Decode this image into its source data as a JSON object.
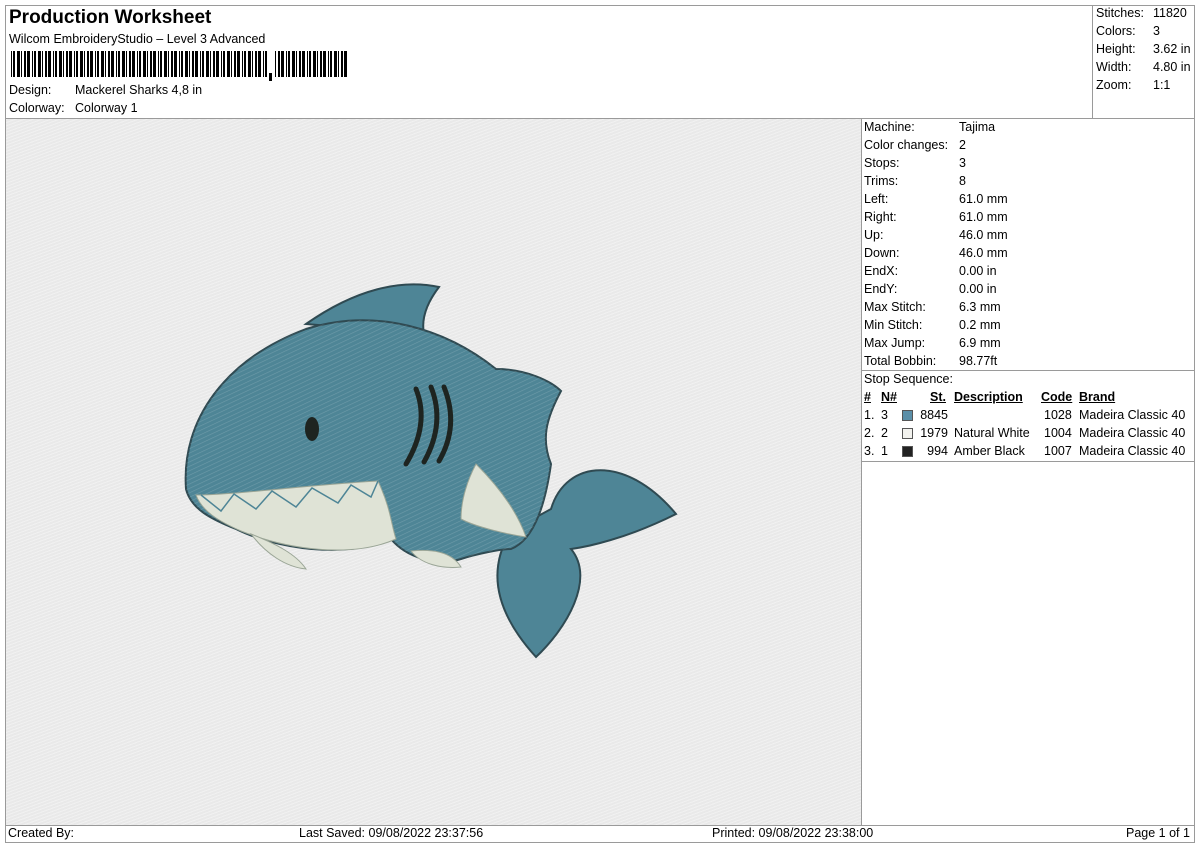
{
  "header": {
    "title": "Production Worksheet",
    "subtitle": "Wilcom EmbroideryStudio – Level 3 Advanced",
    "design_label": "Design:",
    "design_value": "Mackerel Sharks 4,8 in",
    "colorway_label": "Colorway:",
    "colorway_value": "Colorway 1"
  },
  "stats": {
    "stitches_label": "Stitches:",
    "stitches_value": "11820",
    "colors_label": "Colors:",
    "colors_value": "3",
    "height_label": "Height:",
    "height_value": "3.62 in",
    "width_label": "Width:",
    "width_value": "4.80 in",
    "zoom_label": "Zoom:",
    "zoom_value": "1:1"
  },
  "machine": {
    "rows": [
      {
        "label": "Machine:",
        "value": "Tajima"
      },
      {
        "label": "Color changes:",
        "value": "2"
      },
      {
        "label": "Stops:",
        "value": "3"
      },
      {
        "label": "Trims:",
        "value": "8"
      },
      {
        "label": "Left:",
        "value": "61.0 mm"
      },
      {
        "label": "Right:",
        "value": "61.0 mm"
      },
      {
        "label": "Up:",
        "value": "46.0 mm"
      },
      {
        "label": "Down:",
        "value": "46.0 mm"
      },
      {
        "label": "EndX:",
        "value": "0.00 in"
      },
      {
        "label": "EndY:",
        "value": "0.00 in"
      },
      {
        "label": "Max Stitch:",
        "value": "6.3 mm"
      },
      {
        "label": "Min Stitch:",
        "value": "0.2 mm"
      },
      {
        "label": "Max Jump:",
        "value": "6.9 mm"
      },
      {
        "label": "Total Bobbin:",
        "value": "98.77ft"
      }
    ]
  },
  "sequence": {
    "title": "Stop Sequence:",
    "headers": {
      "num": "#",
      "n": "N#",
      "st": "St.",
      "description": "Description",
      "code": "Code",
      "brand": "Brand"
    },
    "rows": [
      {
        "num": "1.",
        "n": "3",
        "color": "#5b8fa8",
        "st": "8845",
        "description": "",
        "code": "1028",
        "brand": "Madeira Classic 40"
      },
      {
        "num": "2.",
        "n": "2",
        "color": "#f2f2ee",
        "st": "1979",
        "description": "Natural White",
        "code": "1004",
        "brand": "Madeira Classic 40"
      },
      {
        "num": "3.",
        "n": "1",
        "color": "#222222",
        "st": "994",
        "description": "Amber Black",
        "code": "1007",
        "brand": "Madeira Classic 40"
      }
    ]
  },
  "footer": {
    "created_by": "Created By:",
    "last_saved": "Last Saved: 09/08/2022 23:37:56",
    "printed": "Printed: 09/08/2022 23:38:00",
    "page": "Page 1 of 1"
  },
  "colors": {
    "shark_body": "#4e8596",
    "shark_outline": "#2f4a52",
    "belly": "#dfe3d6",
    "eye": "#1e2420",
    "canvas": "#e9e9e9"
  }
}
